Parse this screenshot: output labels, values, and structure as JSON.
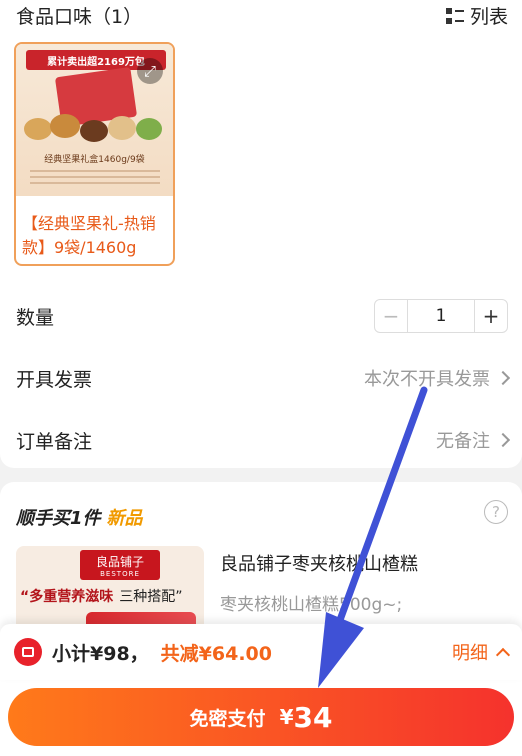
{
  "header": {
    "title": "食品口味（1）",
    "view_toggle_label": "列表"
  },
  "product": {
    "image_banner": "累计卖出超2169万包",
    "image_caption": "经典坚果礼盒1460g/9袋",
    "name": "【经典坚果礼-热销款】9袋/1460g"
  },
  "quantity": {
    "label": "数量",
    "minus": "−",
    "value": "1",
    "plus": "+"
  },
  "invoice": {
    "label": "开具发票",
    "value": "本次不开具发票"
  },
  "remark": {
    "label": "订单备注",
    "value": "无备注"
  },
  "addon": {
    "title": "顺手买1件",
    "badge": "新品",
    "help": "?",
    "item_logo": "良品铺子",
    "item_logo_sub": "BESTORE",
    "item_slogan": "“多重营养滋味",
    "item_slogan_extra": "三种搭配”",
    "item_name": "良品铺子枣夹核桃山楂糕",
    "item_desc": "枣夹核桃山楂糕500g~;"
  },
  "summary": {
    "subtotal": "小计¥98，",
    "discount": "共减¥64.00",
    "detail_label": "明细"
  },
  "pay": {
    "label": "免密支付",
    "currency": "¥",
    "amount": "34"
  },
  "colors": {
    "accent": "#f3641a",
    "pay_start": "#ff7a1a",
    "pay_end": "#f5322d",
    "annotation_arrow": "#3f51d6"
  }
}
